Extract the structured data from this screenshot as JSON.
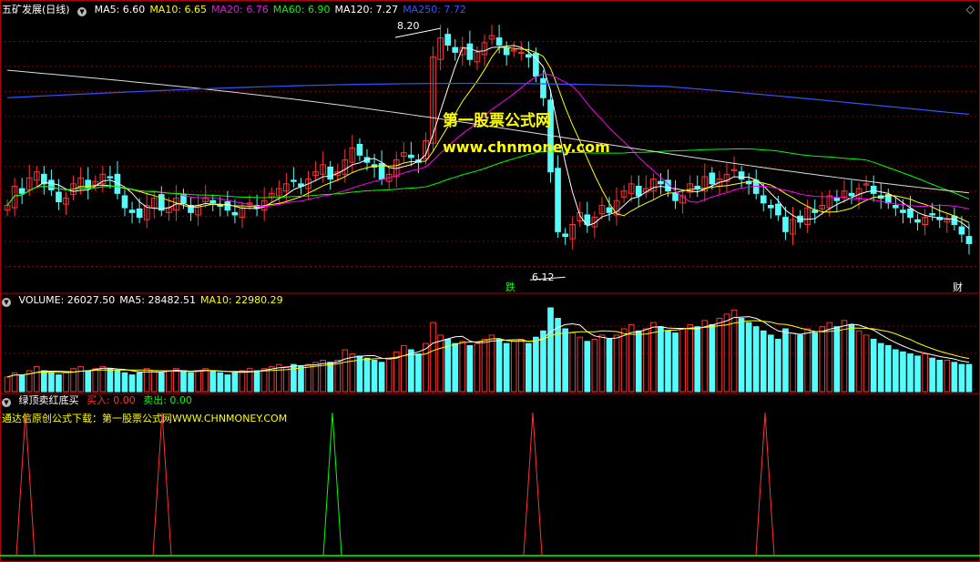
{
  "price_panel": {
    "stock_name": "五矿发展(日线)",
    "ma_labels": [
      {
        "text": "MA5: 6.60",
        "color": "#ffffff"
      },
      {
        "text": "MA10: 6.65",
        "color": "#ffff00"
      },
      {
        "text": "MA20: 6.76",
        "color": "#ff00ff"
      },
      {
        "text": "MA60: 6.90",
        "color": "#00ff00"
      },
      {
        "text": "MA120: 7.27",
        "color": "#ffffff"
      },
      {
        "text": "MA250: 7.72",
        "color": "#3355ff"
      }
    ],
    "high_label": "8.20",
    "low_label": "6.12",
    "tag_fall": "跌",
    "tag_finance": "财",
    "watermark_title": "第一股票公式网",
    "watermark_url": "www.chnmoney.com"
  },
  "volume_panel": {
    "labels": [
      {
        "text": "VOLUME: 26027.50",
        "color": "#ffffff"
      },
      {
        "text": "MA5: 28482.51",
        "color": "#ffffff"
      },
      {
        "text": "MA10: 22980.29",
        "color": "#ffff00"
      }
    ]
  },
  "indicator_panel": {
    "name": "绿顶卖红底买",
    "buy_label": "买入: 0.00",
    "sell_label": "卖出: 0.00",
    "source_note": "通达信原创公式下载：第一股票公式网WWW.CHNMONEY.COM"
  },
  "colors": {
    "up": "#ff3232",
    "down": "#54fcfc",
    "grid": "#8b0000",
    "buy_signal": "#ff3232",
    "sell_signal": "#00ff00"
  },
  "chart_data": {
    "type": "candlestick",
    "ylim": [
      6.0,
      8.3
    ],
    "high": 8.2,
    "low": 6.12,
    "close": [
      6.72,
      6.88,
      6.82,
      6.95,
      7.0,
      6.9,
      6.85,
      6.75,
      6.78,
      6.9,
      6.95,
      6.86,
      6.92,
      6.98,
      6.95,
      6.82,
      6.7,
      6.66,
      6.62,
      6.72,
      6.78,
      6.68,
      6.7,
      6.78,
      6.74,
      6.66,
      6.72,
      6.78,
      6.74,
      6.72,
      6.68,
      6.64,
      6.7,
      6.74,
      6.7,
      6.76,
      6.82,
      6.86,
      6.9,
      6.92,
      6.88,
      6.94,
      7.0,
      7.06,
      6.94,
      7.0,
      7.1,
      7.2,
      7.14,
      7.08,
      7.04,
      6.94,
      6.98,
      7.1,
      7.16,
      7.12,
      7.08,
      7.26,
      7.96,
      8.12,
      8.06,
      8.0,
      8.04,
      7.94,
      8.0,
      8.08,
      8.14,
      8.06,
      7.98,
      8.02,
      8.0,
      7.96,
      7.8,
      7.62,
      7.0,
      6.5,
      6.46,
      6.56,
      6.66,
      6.56,
      6.62,
      6.72,
      6.66,
      6.76,
      6.84,
      6.9,
      6.8,
      6.86,
      6.94,
      6.9,
      6.84,
      6.76,
      6.8,
      6.9,
      6.86,
      6.96,
      6.9,
      6.94,
      6.98,
      7.02,
      6.94,
      6.9,
      6.82,
      6.74,
      6.7,
      6.64,
      6.5,
      6.6,
      6.58,
      6.7,
      6.66,
      6.72,
      6.8,
      6.76,
      6.84,
      6.8,
      6.86,
      6.9,
      6.82,
      6.78,
      6.74,
      6.7,
      6.66,
      6.62,
      6.58,
      6.62,
      6.64,
      6.6,
      6.6,
      6.56,
      6.48,
      6.4
    ],
    "volume": [
      14,
      18,
      16,
      20,
      24,
      20,
      18,
      16,
      18,
      22,
      24,
      20,
      22,
      24,
      22,
      20,
      18,
      16,
      18,
      22,
      20,
      18,
      20,
      22,
      20,
      18,
      20,
      22,
      20,
      18,
      16,
      18,
      20,
      22,
      20,
      22,
      24,
      26,
      24,
      26,
      24,
      26,
      28,
      30,
      28,
      30,
      40,
      36,
      34,
      32,
      30,
      28,
      32,
      38,
      44,
      40,
      36,
      46,
      66,
      54,
      50,
      46,
      48,
      44,
      46,
      50,
      54,
      50,
      46,
      48,
      50,
      46,
      52,
      58,
      80,
      70,
      60,
      56,
      52,
      48,
      50,
      54,
      50,
      54,
      60,
      64,
      58,
      60,
      66,
      62,
      58,
      56,
      60,
      64,
      62,
      68,
      64,
      70,
      74,
      78,
      70,
      66,
      62,
      58,
      54,
      50,
      60,
      56,
      54,
      60,
      56,
      62,
      66,
      62,
      68,
      64,
      58,
      54,
      50,
      46,
      44,
      40,
      38,
      36,
      34,
      36,
      32,
      30,
      30,
      28,
      26,
      26
    ],
    "signals": [
      {
        "index": 7,
        "type": "buy"
      },
      {
        "index": 45,
        "type": "buy"
      },
      {
        "index": 94,
        "type": "sell"
      },
      {
        "index": 149,
        "type": "buy"
      },
      {
        "index": 214,
        "type": "buy"
      }
    ]
  }
}
